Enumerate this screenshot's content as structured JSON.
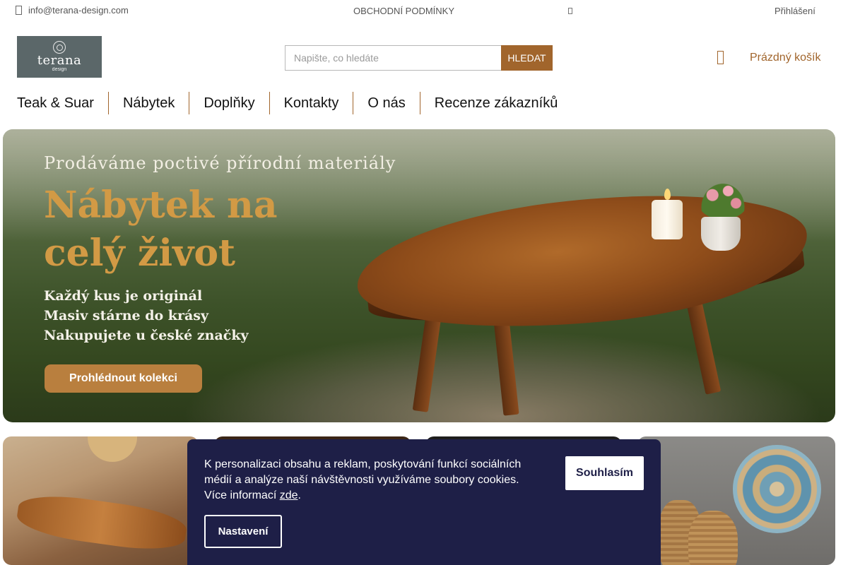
{
  "topbar": {
    "email": "info@terana-design.com",
    "terms": "OBCHODNÍ PODMÍNKY",
    "login": "Přihlášení"
  },
  "header": {
    "logo": {
      "name": "terana",
      "sub": "design"
    },
    "search": {
      "placeholder": "Napište, co hledáte",
      "button_label": "HLEDAT"
    },
    "cart": {
      "label": "Prázdný košík"
    }
  },
  "nav": {
    "items": [
      "Teak & Suar",
      "Nábytek",
      "Doplňky",
      "Kontakty",
      "O nás",
      "Recenze zákazníků"
    ]
  },
  "hero": {
    "subtitle": "Prodáváme poctivé přírodní materiály",
    "title_line1": "Nábytek na",
    "title_line2": "celý život",
    "points": [
      "Každý kus je originál",
      "Masiv stárne do krásy",
      "Nakupujete u české značky"
    ],
    "cta_label": "Prohlédnout kolekci"
  },
  "cookie": {
    "text_main": "K personalizaci obsahu a reklam, poskytování funkcí sociálních médií a analýze naší návštěvnosti využíváme soubory cookies. Více informací ",
    "link_label": "zde",
    "text_end": ".",
    "accept_label": "Souhlasím",
    "settings_label": "Nastavení"
  },
  "colors": {
    "accent": "#a1652c",
    "hero_title": "#d29a45",
    "cookie_bg": "#1e1f47"
  },
  "icons": [
    "mail-icon",
    "cart-icon"
  ]
}
